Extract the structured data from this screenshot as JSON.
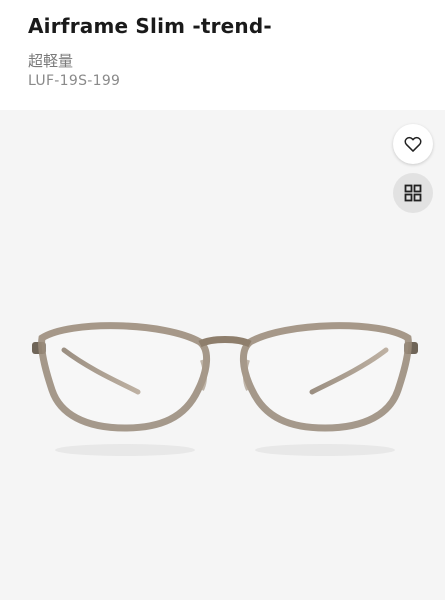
{
  "product": {
    "name": "Airframe Slim -trend-",
    "subtitle": "超軽量",
    "sku": "LUF-19S-199"
  },
  "actions": {
    "favorite_icon": "heart-outline-icon",
    "gallery_icon": "grid-icon"
  },
  "colors": {
    "frame": "#8e7e6c",
    "background": "#f5f5f5",
    "button_gray": "#e2e2e2"
  }
}
